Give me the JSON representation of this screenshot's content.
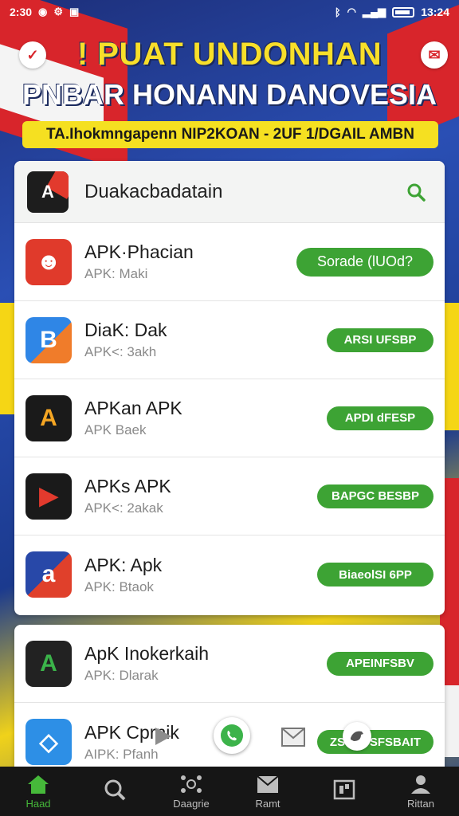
{
  "status_bar": {
    "time_left": "2:30",
    "time_right": "13:24"
  },
  "header": {
    "title": "! PUAT UNDONHAN",
    "subtitle": "PNBAR HONANN DANOVESIA",
    "strip_text": "TA.Ihokmngapenn NIP2KOAN - 2UF 1/DGAIL AMBN"
  },
  "search": {
    "logo_text": "A",
    "title": "Duakacbadatain"
  },
  "apps": [
    {
      "name": "APK·Phacian",
      "sub": "APK: Maki",
      "button": "Sorade (lUOd?",
      "icon": "red-monster-icon",
      "color": "#e03a2b",
      "glyph": "☻"
    },
    {
      "name": "DiaK: Dak",
      "sub": "APK<: 3akh",
      "button": "ARSI UFSBP",
      "icon": "blue-b-icon",
      "color": "#2f86e6",
      "glyph": "B"
    },
    {
      "name": "APKan APK",
      "sub": "APK Baek",
      "button": "APDI dFESP",
      "icon": "black-a-icon",
      "color": "#1a1a1a",
      "glyph": "A"
    },
    {
      "name": "APKs APK",
      "sub": "APK<: 2akak",
      "button": "BAPGC BESBP",
      "icon": "red-play-icon",
      "color": "#1a1a1a",
      "glyph": "▶"
    },
    {
      "name": "APK: Apk",
      "sub": "APK: Btaok",
      "button": "BiaeolSI 6PP",
      "icon": "multicolor-a-icon",
      "color": "#2848a8",
      "glyph": "a"
    }
  ],
  "apps_second": [
    {
      "name": "ApK Inokerkaih",
      "sub": "APK: Dlarak",
      "button": "APEINFSBV",
      "icon": "hex-a-icon",
      "color": "#222222",
      "glyph": "A"
    },
    {
      "name": "APK Cprnik",
      "sub": "AIPK: Pfanh",
      "button": "ZSGCI SFSBAIT",
      "icon": "blue-outline-icon",
      "color": "#2d8fe6",
      "glyph": "◇"
    }
  ],
  "bottom_nav": [
    {
      "label": "Haad",
      "icon": "home-icon",
      "active": true
    },
    {
      "label": "",
      "icon": "search-icon",
      "active": false
    },
    {
      "label": "Daagrie",
      "icon": "network-icon",
      "active": false
    },
    {
      "label": "Ramt",
      "icon": "inbox-icon",
      "active": false
    },
    {
      "label": "",
      "icon": "grid-icon",
      "active": false
    },
    {
      "label": "Rittan",
      "icon": "person-icon",
      "active": false
    }
  ],
  "colors": {
    "accent_green": "#3da334",
    "banner_yellow": "#f5e021",
    "flag_red": "#d8252b"
  }
}
